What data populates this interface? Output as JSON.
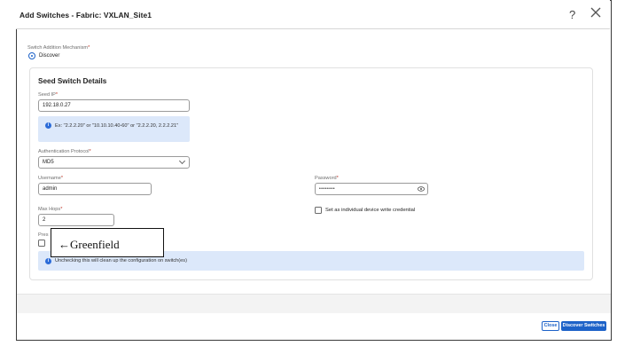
{
  "dialog": {
    "title": "Add Switches - Fabric: VXLAN_Site1",
    "help_glyph": "?"
  },
  "mechanism": {
    "label": "Switch Addition Mechanism",
    "required_mark": "*",
    "option_label": "Discover"
  },
  "seed": {
    "section_title": "Seed Switch Details",
    "ip_label": "Seed IP",
    "ip_value": "192.18.0.27",
    "ip_hint": "Ex: \"2.2.2.20\" or \"10.10.10.40-60\" or \"2.2.2.20, 2.2.2.21\"",
    "auth_label": "Authentication Protocol",
    "auth_value": "MD5",
    "username_label": "Username",
    "username_value": "admin",
    "password_label": "Password",
    "password_value": "••••••••",
    "maxhops_label": "Max Hops",
    "maxhops_value": "2",
    "credential_checkbox_label": "Set as individual device write credential",
    "preserve_label_fragment": "Pres",
    "preserve_warning": "Unchecking this will clean up the configuration on switch(es)"
  },
  "annotation": {
    "callout_text": "←Greenfield"
  },
  "footer": {
    "close_label": "Close",
    "discover_label": "Discover Switches"
  },
  "colors": {
    "accent": "#1d62c8",
    "info_bg": "#dce8fa",
    "required": "#c0392b"
  },
  "icons": {
    "help": "help-icon",
    "close": "close-icon",
    "info": "info-icon",
    "eye": "eye-icon",
    "chevron": "chevron-down-icon"
  }
}
